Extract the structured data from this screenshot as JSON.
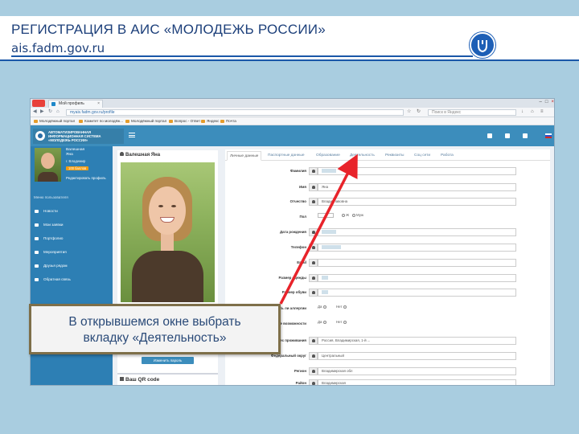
{
  "slide": {
    "title": "РЕГИСТРАЦИЯ В АИС «МОЛОДЕЖЬ РОССИИ»",
    "subtitle": "ais.fadm.gov.ru",
    "logo_icon": "shield-logo-icon",
    "accent_color": "#1a57a8"
  },
  "browser": {
    "tab_label": "Мой профиль",
    "address": "myais.fadm.gov.ru/profile",
    "search_placeholder": "Поиск в Яндекс",
    "bookmarks": [
      "Молодёжный портал",
      "Комитет по молодёж...",
      "Молодёжный портал",
      "Вопрос - Ответ",
      "Яндекс",
      "Почта"
    ]
  },
  "site": {
    "logo_text": "АВТОМАТИЗИРОВАННАЯ ИНФОРМАЦИОННАЯ СИСТЕМА «МОЛОДЕЖЬ РОССИИ»",
    "header_color": "#3c8dbc"
  },
  "sidebar": {
    "user_first": "Валешная",
    "user_second": "Яна",
    "user_city": "г. Владимир",
    "user_badge": "100 баллов",
    "edit_link": "Редактировать профиль",
    "menu_title": "Меню пользователя",
    "items": [
      "Новости",
      "Мои заявки",
      "Портфолио",
      "Мероприятия",
      "Друзья рядом",
      "Обратная связь"
    ]
  },
  "profile": {
    "name": "Валешная Яна",
    "change_password": "Изменить пароль",
    "qr_title": "Ваш QR code"
  },
  "form": {
    "tabs": [
      "Личные данные",
      "Паспортные данные",
      "Образование",
      "Деятельность",
      "Реквизиты",
      "Соц сети",
      "Работа"
    ],
    "active_tab": "Личные данные",
    "rows": [
      {
        "label": "Фамилия",
        "value": "Валешная"
      },
      {
        "label": "Имя",
        "value": "Яна"
      },
      {
        "label": "Отчество",
        "value": "Владиславовна"
      },
      {
        "label": "Пол",
        "value": ""
      },
      {
        "label": "Дата рождения",
        "value": ""
      },
      {
        "label": "Телефон",
        "value": ""
      },
      {
        "label": "Email",
        "value": ""
      },
      {
        "label": "Размер одежды",
        "value": ""
      },
      {
        "label": "Размер обуви",
        "value": ""
      },
      {
        "label": "Есть ли аллергии",
        "value": ""
      },
      {
        "label": "Ограниченные возможности",
        "value": ""
      },
      {
        "label": "Адрес проживания",
        "value": "Россия, Владимирская, 1-й ..."
      },
      {
        "label": "Федеральный округ",
        "value": "Центральный"
      },
      {
        "label": "Регион",
        "value": "Владимирская обл"
      },
      {
        "label": "Район",
        "value": "Владимирская"
      }
    ],
    "gender_options": [
      "Ж",
      "Муж"
    ],
    "yes_no": [
      "Да",
      "Нет"
    ]
  },
  "callout": {
    "line1": "В открывшемся окне выбрать",
    "line2": "вкладку «Деятельность»",
    "border_color": "#7e6f49",
    "arrow_color": "#e8232a"
  }
}
